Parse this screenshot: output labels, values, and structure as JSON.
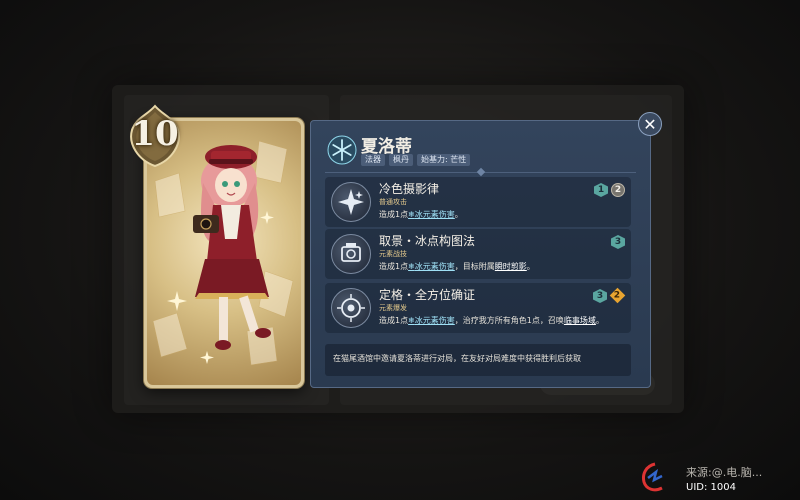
{
  "card": {
    "cost": "10",
    "icons": {
      "cost_badge": "die-cost-badge",
      "art": "character-portrait"
    }
  },
  "character": {
    "name": "夏洛蒂",
    "element_icon": "cryo-icon",
    "tags": [
      "法器",
      "枫丹",
      "始基力: 芒性"
    ]
  },
  "skills": [
    {
      "name": "冷色摄影律",
      "type": "普通攻击",
      "icon": "camera-sparkle-icon",
      "desc_prefix": "造成1点",
      "desc_link": "冰元素伤害",
      "desc_suffix": "。",
      "desc_extra": "",
      "desc_kw": "",
      "desc_end": "",
      "costs": [
        {
          "kind": "cryo",
          "value": "1"
        },
        {
          "kind": "any",
          "value": "2"
        }
      ]
    },
    {
      "name": "取景・冰点构图法",
      "type": "元素战技",
      "icon": "camera-frame-icon",
      "desc_prefix": "造成1点",
      "desc_link": "冰元素伤害",
      "desc_suffix": "，目标附属",
      "desc_extra": "",
      "desc_kw": "瞬时剪影",
      "desc_end": "。",
      "costs": [
        {
          "kind": "cryo",
          "value": "3"
        }
      ]
    },
    {
      "name": "定格・全方位确证",
      "type": "元素爆发",
      "icon": "camera-burst-icon",
      "desc_prefix": "造成1点",
      "desc_link": "冰元素伤害",
      "desc_suffix": "，治疗我方所有角色1点，召唤",
      "desc_extra": "",
      "desc_kw": "临事场域",
      "desc_end": "。",
      "costs": [
        {
          "kind": "cryo",
          "value": "3"
        },
        {
          "kind": "energy",
          "value": "2"
        }
      ]
    }
  ],
  "footer": {
    "text": "在猫尾酒馆中邀请夏洛蒂进行对局，在友好对局难度中获得胜利后获取"
  },
  "close_icon": "close-icon",
  "watermark": {
    "text": "来源:@.电.脑...",
    "uid": "UID: 1004"
  },
  "colors": {
    "panel": "#2f4056",
    "cryo": "#9fe0f5",
    "energy": "#e8a430",
    "card_frame": "#d9c79a"
  }
}
